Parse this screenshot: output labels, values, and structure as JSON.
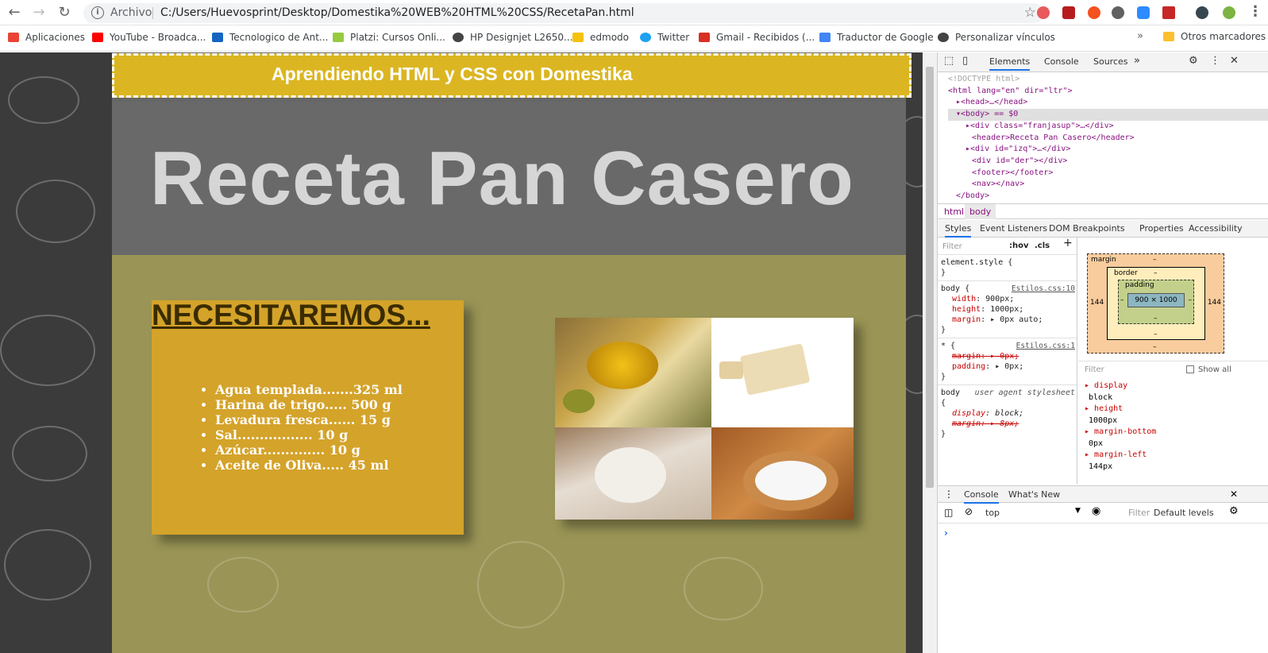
{
  "browser": {
    "scheme_label": "Archivo",
    "url": "C:/Users/Huevosprint/Desktop/Domestika%20WEB%20HTML%20CSS/RecetaPan.html",
    "bookmarks": [
      {
        "label": "Aplicaciones",
        "icon": "apps-grid-icon",
        "color": "#ea4335"
      },
      {
        "label": "YouTube - Broadca...",
        "icon": "youtube-icon",
        "color": "#ff0000"
      },
      {
        "label": "Tecnologico de Ant...",
        "icon": "infinity-icon",
        "color": "#1565c0"
      },
      {
        "label": "Platzi: Cursos Onli...",
        "icon": "platzi-icon",
        "color": "#98ca3f"
      },
      {
        "label": "HP Designjet L2650...",
        "icon": "globe-icon",
        "color": "#444444"
      },
      {
        "label": "edmodo",
        "icon": "edmodo-icon",
        "color": "#f4c20d"
      },
      {
        "label": "Twitter",
        "icon": "twitter-icon",
        "color": "#1da1f2"
      },
      {
        "label": "Gmail - Recibidos (...",
        "icon": "gmail-icon",
        "color": "#d93025"
      },
      {
        "label": "Traductor de Google",
        "icon": "translate-icon",
        "color": "#4285f4"
      },
      {
        "label": "Personalizar vínculos",
        "icon": "globe-icon",
        "color": "#444444"
      }
    ],
    "bookmarks_more": "»",
    "other_bookmarks": "Otros marcadores"
  },
  "page": {
    "banner": "Aprendiendo HTML y CSS con Domestika",
    "title": "Receta Pan Casero",
    "ingredients_heading": "NECESITAREMOS...",
    "ingredients": [
      "Agua templada.......325 ml",
      "Harina de trigo..... 500 g",
      "Levadura fresca...... 15 g",
      "Sal................. 10 g",
      "Azúcar.............. 10 g",
      "Aceite de Oliva..... 45 ml"
    ],
    "photos": [
      "olive-oil-photo",
      "yeast-photo",
      "flour-photo",
      "salt-photo"
    ]
  },
  "devtools": {
    "tabs": [
      "Elements",
      "Console",
      "Sources"
    ],
    "tabs_more": "»",
    "dom": [
      {
        "text": "<!DOCTYPE html>",
        "kind": "gray"
      },
      {
        "text": "<html lang=\"en\" dir=\"ltr\">",
        "kind": "tag"
      },
      {
        "text": "▸<head>…</head>",
        "kind": "tag"
      },
      {
        "text": "▾<body> == $0",
        "kind": "tag"
      },
      {
        "text": "▸<div class=\"franjasup\">…</div>",
        "kind": "tag"
      },
      {
        "text": "<header>Receta Pan Casero</header>",
        "kind": "tag"
      },
      {
        "text": "▸<div id=\"izq\">…</div>",
        "kind": "tag"
      },
      {
        "text": "<div id=\"der\"></div>",
        "kind": "tag"
      },
      {
        "text": "<footer></footer>",
        "kind": "tag"
      },
      {
        "text": "<nav></nav>",
        "kind": "tag"
      },
      {
        "text": "</body>",
        "kind": "tag"
      }
    ],
    "crumbs": [
      "html",
      "body"
    ],
    "sub_tabs": [
      "Styles",
      "Event Listeners",
      "DOM Breakpoints",
      "Properties",
      "Accessibility"
    ],
    "filter_placeholder": "Filter",
    "hov": ":hov",
    "cls": ".cls",
    "styles": {
      "element_style": "element.style {",
      "body_selector": "body {",
      "body_src": "Estilos.css:10",
      "body_props": [
        {
          "p": "width",
          "v": "900px;"
        },
        {
          "p": "height",
          "v": "1000px;"
        },
        {
          "p": "margin",
          "v": "▸ 0px auto;"
        }
      ],
      "star_selector": "* {",
      "star_src": "Estilos.css:1",
      "star_props": [
        {
          "p": "margin",
          "v": "▸ 0px;",
          "struck": true
        },
        {
          "p": "padding",
          "v": "▸ 0px;",
          "struck": false
        }
      ],
      "ua_selector": "body",
      "ua_label": "user agent stylesheet",
      "ua_props": [
        {
          "p": "display",
          "v": "block;",
          "struck": false
        },
        {
          "p": "margin",
          "v": "▸ 8px;",
          "struck": true
        }
      ],
      "close": "}",
      "open": "{"
    },
    "box_model": {
      "margin_label": "margin",
      "border_label": "border",
      "padding_label": "padding",
      "dash": "–",
      "content": "900 × 1000",
      "margin_left": "144",
      "margin_right": "144"
    },
    "computed_filter": "Filter",
    "show_all": "Show all",
    "computed": [
      {
        "p": "display",
        "v": "block"
      },
      {
        "p": "height",
        "v": "1000px"
      },
      {
        "p": "margin-bottom",
        "v": "0px"
      },
      {
        "p": "margin-left",
        "v": "144px"
      }
    ],
    "console_tabs": [
      "Console",
      "What's New"
    ],
    "context": "top",
    "console_filter": "Filter",
    "levels": "Default levels",
    "prompt": "›"
  }
}
